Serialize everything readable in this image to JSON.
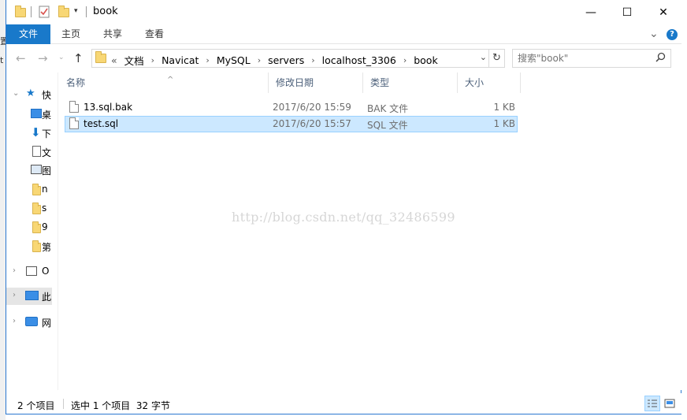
{
  "window": {
    "title": "book",
    "controls": {
      "minimize": "—",
      "maximize": "☐",
      "close": "✕"
    },
    "help_glyph": "?",
    "expand_ribbon_glyph": "⌄"
  },
  "left_strip": {
    "chars": [
      "置",
      "t"
    ]
  },
  "ribbon": {
    "tabs": [
      {
        "label": "文件"
      },
      {
        "label": "主页"
      },
      {
        "label": "共享"
      },
      {
        "label": "查看"
      }
    ]
  },
  "address": {
    "overflow": "«",
    "crumbs": [
      "文档",
      "Navicat",
      "MySQL",
      "servers",
      "localhost_3306",
      "book"
    ],
    "dropdown_glyph": "⌄",
    "refresh_glyph": "↻"
  },
  "search": {
    "placeholder": "搜索\"book\""
  },
  "navpane": {
    "items": [
      {
        "label": "快",
        "icon": "star-icon",
        "expand": "⌄"
      },
      {
        "label": "桌",
        "icon": "desktop-icon"
      },
      {
        "label": "下",
        "icon": "download-icon"
      },
      {
        "label": "文",
        "icon": "document-icon"
      },
      {
        "label": "图",
        "icon": "picture-icon"
      },
      {
        "label": "n",
        "icon": "folder-icon"
      },
      {
        "label": "s",
        "icon": "folder-icon"
      },
      {
        "label": "9",
        "icon": "folder-icon"
      },
      {
        "label": "第",
        "icon": "folder-icon"
      },
      {
        "label": "O",
        "icon": "onedrive-icon",
        "expand": "›"
      },
      {
        "label": "此",
        "icon": "this-pc-icon",
        "expand": "›"
      },
      {
        "label": "网",
        "icon": "network-icon",
        "expand": "›"
      }
    ]
  },
  "columns": {
    "name": "名称",
    "modified": "修改日期",
    "type": "类型",
    "size": "大小",
    "sort_glyph": "^"
  },
  "files": [
    {
      "name": "13.sql.bak",
      "modified": "2017/6/20 15:59",
      "type": "BAK 文件",
      "size": "1 KB",
      "selected": false
    },
    {
      "name": "test.sql",
      "modified": "2017/6/20 15:57",
      "type": "SQL 文件",
      "size": "1 KB",
      "selected": true
    }
  ],
  "watermark": "http://blog.csdn.net/qq_32486599",
  "status": {
    "item_count": "2 个项目",
    "selection": "选中 1 个项目  32 字节"
  },
  "colors": {
    "accent": "#1979ca",
    "selection_bg": "#cce8ff",
    "selection_border": "#99d1ff",
    "folder": "#f8d775",
    "header_text": "#4c607a"
  }
}
